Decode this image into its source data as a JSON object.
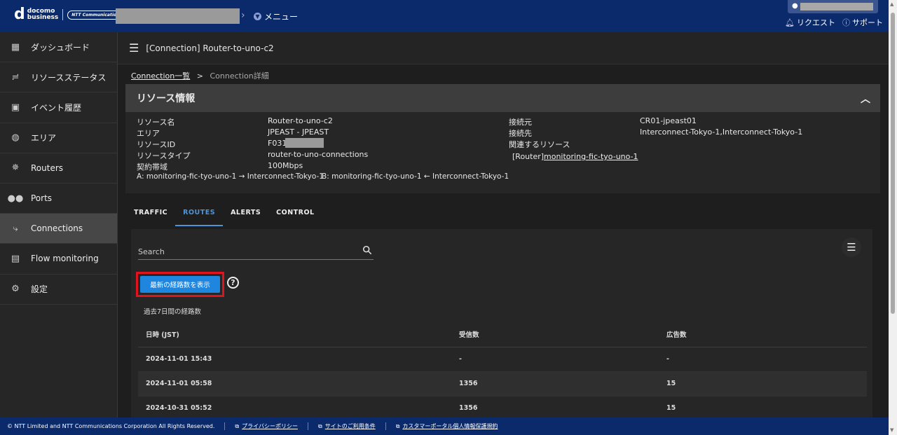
{
  "header": {
    "logo_mark": "d",
    "logo_line1": "docomo",
    "logo_line2": "business",
    "ntt_logo": "NTT Communications",
    "menu_label": "メニュー",
    "request_label": "リクエスト",
    "support_label": "サポート"
  },
  "sidebar": {
    "items": [
      {
        "label": "ダッシュボード",
        "icon": "grid-icon"
      },
      {
        "label": "リソースステータス",
        "icon": "status-icon"
      },
      {
        "label": "イベント履歴",
        "icon": "calendar-icon"
      },
      {
        "label": "エリア",
        "icon": "globe-icon"
      },
      {
        "label": "Routers",
        "icon": "router-icon"
      },
      {
        "label": "Ports",
        "icon": "port-icon"
      },
      {
        "label": "Connections",
        "icon": "connection-icon"
      },
      {
        "label": "Flow monitoring",
        "icon": "document-icon"
      },
      {
        "label": "設定",
        "icon": "gear-icon"
      }
    ],
    "active": "Connections"
  },
  "page": {
    "title": "[Connection] Router-to-uno-c2",
    "breadcrumb_parent": "Connection一覧",
    "breadcrumb_sep": ">",
    "breadcrumb_current": "Connection詳細"
  },
  "resource": {
    "panel_title": "リソース情報",
    "name_label": "リソース名",
    "name_value": "Router-to-uno-c2",
    "area_label": "エリア",
    "area_value": "JPEAST - JPEAST",
    "id_label": "リソースID",
    "id_value": "F031",
    "type_label": "リソースタイプ",
    "type_value": "router-to-uno-connections",
    "bandwidth_label": "契約帯域",
    "bandwidth_value": "100Mbps",
    "path_a": "A: monitoring-fic-tyo-uno-1 → Interconnect-Tokyo-1",
    "path_b": "B: monitoring-fic-tyo-uno-1 ← Interconnect-Tokyo-1",
    "source_label": "接続元",
    "source_value": "CR01-jpeast01",
    "dest_label": "接続先",
    "dest_value": "Interconnect-Tokyo-1,Interconnect-Tokyo-1",
    "related_label": "関連するリソース",
    "related_type": "[Router]",
    "related_link": "monitoring-fic-tyo-uno-1"
  },
  "tabs": [
    "TRAFFIC",
    "ROUTES",
    "ALERTS",
    "CONTROL"
  ],
  "active_tab": "ROUTES",
  "routes": {
    "search_placeholder": "Search",
    "show_latest_button": "最新の経路数を表示",
    "help_symbol": "?",
    "section_title": "過去7日間の経路数",
    "columns": [
      "日時 (JST)",
      "受信数",
      "広告数"
    ],
    "rows": [
      [
        "2024-11-01 15:43",
        "-",
        "-"
      ],
      [
        "2024-11-01 05:58",
        "1356",
        "15"
      ],
      [
        "2024-10-31 05:52",
        "1356",
        "15"
      ]
    ]
  },
  "footer": {
    "copyright": "© NTT Limited and NTT Communications Corporation All Rights Reserved.",
    "privacy": "プライバシーポリシー",
    "terms": "サイトのご利用条件",
    "customer_privacy": "カスタマーポータル個人情報保護規約"
  },
  "colors": {
    "header_bg": "#0a2a6b",
    "accent": "#1f86e0",
    "tab_active": "#4e94d8",
    "highlight": "#e0141e"
  }
}
